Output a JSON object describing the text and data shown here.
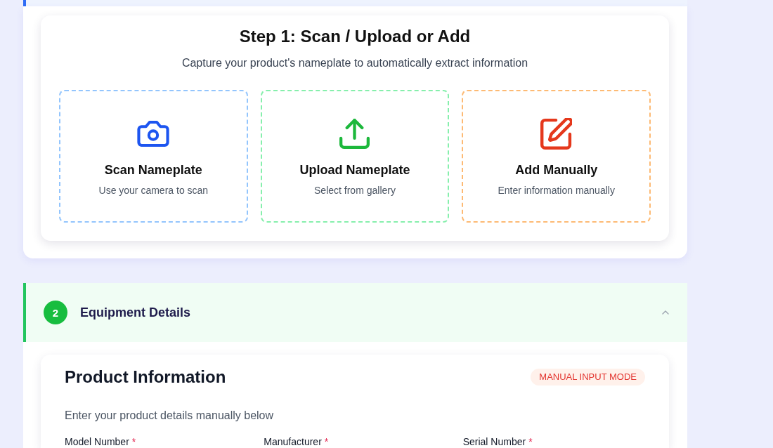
{
  "step_1": {
    "title": "Step 1: Scan / Upload or Add",
    "subtitle": "Capture your product's nameplate to automatically extract information",
    "options": [
      {
        "kind": "scan",
        "title": "Scan Nameplate",
        "description": "Use your camera to scan"
      },
      {
        "kind": "upload",
        "title": "Upload Nameplate",
        "description": "Select from gallery"
      },
      {
        "kind": "manual",
        "title": "Add Manually",
        "description": "Enter information manually"
      }
    ]
  },
  "equipment_details": {
    "number": "2",
    "title": "Equipment Details",
    "expanded": true,
    "product_information": {
      "title": "Product Information",
      "mode_badge": "MANUAL INPUT MODE",
      "description": "Enter your product details manually below",
      "fields": [
        {
          "label": "Model Number",
          "required_mark": "*"
        },
        {
          "label": "Manufacturer",
          "required_mark": "*"
        },
        {
          "label": "Serial Number",
          "required_mark": "*"
        }
      ]
    }
  }
}
